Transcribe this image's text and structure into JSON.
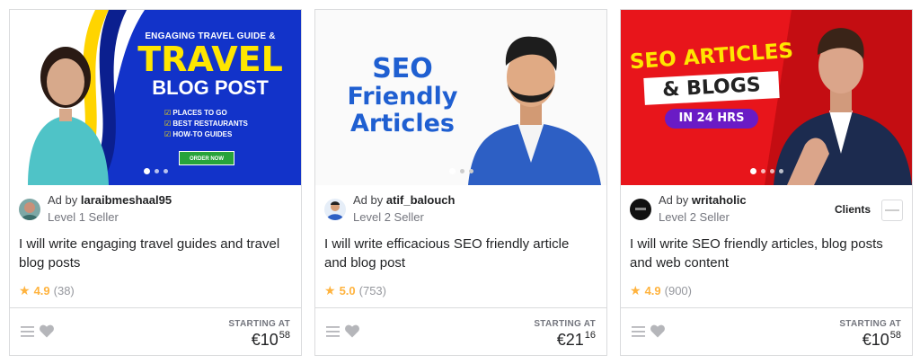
{
  "cards": [
    {
      "banner": {
        "line1": "ENGAGING TRAVEL GUIDE &",
        "line2": "TRAVEL",
        "line3": "BLOG POST",
        "bullets": [
          "PLACES TO GO",
          "BEST RESTAURANTS",
          "HOW-TO GUIDES"
        ],
        "cta": "ORDER NOW"
      },
      "ad_label": "Ad by",
      "seller": "laraibmeshaal95",
      "level": "Level 1 Seller",
      "title": "I will write engaging travel guides and travel blog posts",
      "rating": "4.9",
      "reviews": "(38)",
      "starting_at": "STARTING AT",
      "price_main": "€10",
      "price_cents": "58"
    },
    {
      "banner": {
        "line1": "SEO",
        "line2": "Friendly",
        "line3": "Articles"
      },
      "ad_label": "Ad by",
      "seller": "atif_balouch",
      "level": "Level 2 Seller",
      "title": "I will write efficacious SEO friendly article and blog post",
      "rating": "5.0",
      "reviews": "(753)",
      "starting_at": "STARTING AT",
      "price_main": "€21",
      "price_cents": "16"
    },
    {
      "banner": {
        "line1": "SEO ARTICLES",
        "line2": "& BLOGS",
        "line3": "IN 24 HRS"
      },
      "ad_label": "Ad by",
      "seller": "writaholic",
      "level": "Level 2 Seller",
      "clients_label": "Clients",
      "title": "I will write SEO friendly articles, blog posts and web content",
      "rating": "4.9",
      "reviews": "(900)",
      "starting_at": "STARTING AT",
      "price_main": "€10",
      "price_cents": "58"
    }
  ],
  "colors": {
    "star": "#ffb33e",
    "card1_bg": "#1233c9",
    "card1_accent": "#ffe600",
    "card2_title": "#1f5fd1",
    "card3_bg": "#e8151b",
    "card3_accent": "#ffe600"
  },
  "icons": [
    "list-icon",
    "heart-icon",
    "star-icon"
  ]
}
